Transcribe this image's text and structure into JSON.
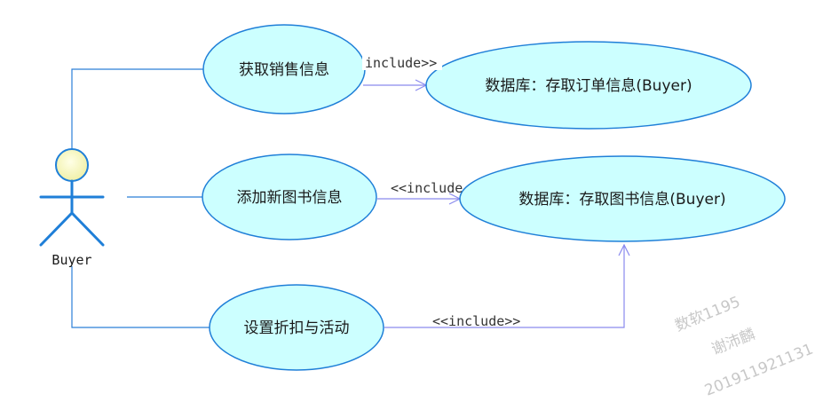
{
  "actor": {
    "name": "Buyer"
  },
  "use_cases": {
    "sales_info": "获取销售信息",
    "add_book": "添加新图书信息",
    "discount": "设置折扣与活动",
    "db_order": "数据库：存取订单信息(Buyer)",
    "db_book": "数据库：存取图书信息(Buyer)"
  },
  "relations": {
    "include_1": "include>>",
    "include_2": "<<include",
    "include_3": "<<include>>"
  },
  "watermark": {
    "line1": "数软1195",
    "line2": "谢沛麟",
    "line3": "201911921131"
  },
  "colors": {
    "ellipse_fill": "#ccffff",
    "ellipse_stroke": "#1f7fd8",
    "line": "#2b7fd8",
    "arrow": "#8a8aee",
    "actor_head": "#ffffcc"
  }
}
